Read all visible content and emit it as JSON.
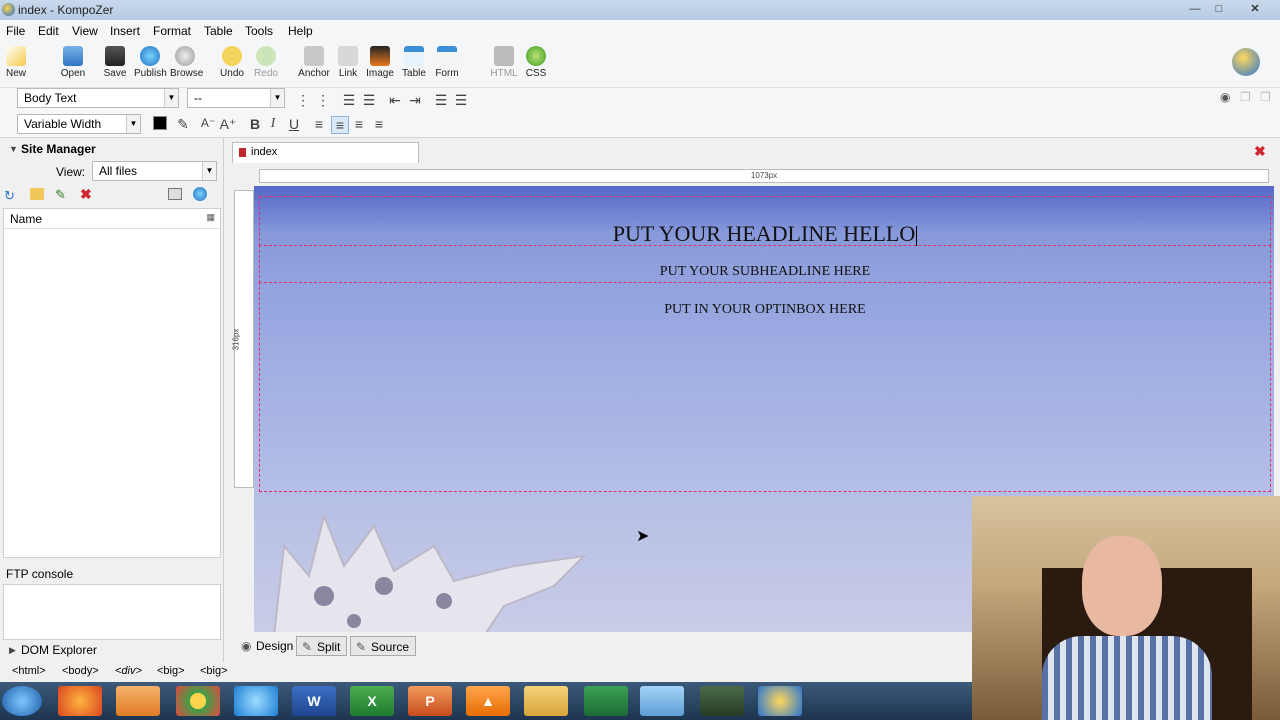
{
  "window": {
    "title": "index - KompoZer",
    "buttons": [
      "minimize",
      "maximize",
      "close"
    ]
  },
  "menu": [
    "File",
    "Edit",
    "View",
    "Insert",
    "Format",
    "Table",
    "Tools",
    "Help"
  ],
  "toolbar": [
    {
      "label": "New",
      "icon": "new-icon",
      "enabled": true
    },
    {
      "label": "Open",
      "icon": "open-icon",
      "enabled": true
    },
    {
      "label": "Save",
      "icon": "save-icon",
      "enabled": true
    },
    {
      "label": "Publish",
      "icon": "publish-icon",
      "enabled": true
    },
    {
      "label": "Browse",
      "icon": "browse-icon",
      "enabled": true
    },
    {
      "label": "Undo",
      "icon": "undo-icon",
      "enabled": true
    },
    {
      "label": "Redo",
      "icon": "redo-icon",
      "enabled": false
    },
    {
      "label": "Anchor",
      "icon": "anchor-icon",
      "enabled": true
    },
    {
      "label": "Link",
      "icon": "link-icon",
      "enabled": true
    },
    {
      "label": "Image",
      "icon": "image-icon",
      "enabled": true
    },
    {
      "label": "Table",
      "icon": "table-icon",
      "enabled": true
    },
    {
      "label": "Form",
      "icon": "form-icon",
      "enabled": true
    },
    {
      "label": "HTML",
      "icon": "html-icon",
      "enabled": false
    },
    {
      "label": "CSS",
      "icon": "css-icon",
      "enabled": true
    }
  ],
  "format_bar": {
    "paragraph_style": "Body Text",
    "class": "--",
    "font": "Variable Width"
  },
  "site_manager": {
    "title": "Site Manager",
    "view_label": "View:",
    "view_value": "All files",
    "column_name": "Name"
  },
  "ftp_console": "FTP console",
  "dom_explorer": "DOM Explorer",
  "editor": {
    "tab": "index",
    "ruler_width_label": "1073px",
    "ruler_height_label": "316px",
    "headline": "PUT YOUR HEADLINE HELLO",
    "subheadline": "PUT YOUR SUBHEADLINE HERE",
    "optinbox": "PUT IN YOUR OPTINBOX HERE"
  },
  "view_tabs": [
    "Design",
    "Split",
    "Source"
  ],
  "status_path": [
    "<html>",
    "<body>",
    "<div>",
    "<big>",
    "<big>"
  ],
  "taskbar": [
    "start-icon",
    "firefox-icon",
    "media-icon",
    "chrome-icon",
    "ie-icon",
    "word-icon",
    "excel-icon",
    "powerpoint-icon",
    "vlc-icon",
    "folder-icon",
    "app-icon",
    "notepad-icon",
    "camtasia-icon",
    "kompozer-icon"
  ],
  "colors": {
    "accent": "#e0306a",
    "taskbar": "#2a4563"
  }
}
